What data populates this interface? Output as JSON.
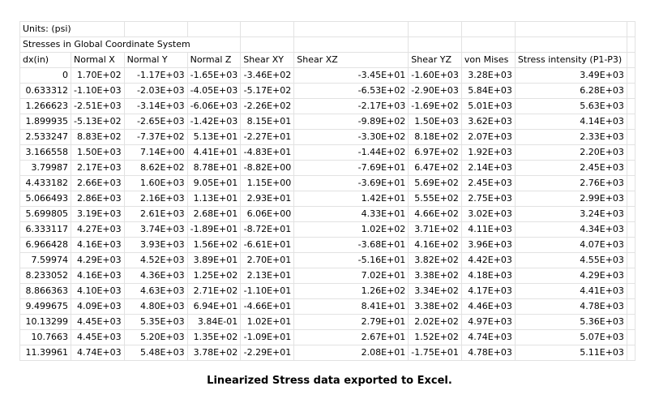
{
  "units_label": "Units: (psi)",
  "section_title": "Stresses in Global Coordinate System",
  "headers": [
    "dx(in)",
    "Normal X",
    "Normal Y",
    "Normal Z",
    "Shear XY",
    "Shear XZ",
    "Shear YZ",
    "von Mises",
    "Stress intensity (P1-P3)"
  ],
  "rows": [
    [
      "0",
      "1.70E+02",
      "-1.17E+03",
      "-1.65E+03",
      "-3.46E+02",
      "-3.45E+01",
      "-1.60E+03",
      "3.28E+03",
      "3.49E+03"
    ],
    [
      "0.633312",
      "-1.10E+03",
      "-2.03E+03",
      "-4.05E+03",
      "-5.17E+02",
      "-6.53E+02",
      "-2.90E+03",
      "5.84E+03",
      "6.28E+03"
    ],
    [
      "1.266623",
      "-2.51E+03",
      "-3.14E+03",
      "-6.06E+03",
      "-2.26E+02",
      "-2.17E+03",
      "-1.69E+02",
      "5.01E+03",
      "5.63E+03"
    ],
    [
      "1.899935",
      "-5.13E+02",
      "-2.65E+03",
      "-1.42E+03",
      "8.15E+01",
      "-9.89E+02",
      "1.50E+03",
      "3.62E+03",
      "4.14E+03"
    ],
    [
      "2.533247",
      "8.83E+02",
      "-7.37E+02",
      "5.13E+01",
      "-2.27E+01",
      "-3.30E+02",
      "8.18E+02",
      "2.07E+03",
      "2.33E+03"
    ],
    [
      "3.166558",
      "1.50E+03",
      "7.14E+00",
      "4.41E+01",
      "-4.83E+01",
      "-1.44E+02",
      "6.97E+02",
      "1.92E+03",
      "2.20E+03"
    ],
    [
      "3.79987",
      "2.17E+03",
      "8.62E+02",
      "8.78E+01",
      "-8.82E+00",
      "-7.69E+01",
      "6.47E+02",
      "2.14E+03",
      "2.45E+03"
    ],
    [
      "4.433182",
      "2.66E+03",
      "1.60E+03",
      "9.05E+01",
      "1.15E+00",
      "-3.69E+01",
      "5.69E+02",
      "2.45E+03",
      "2.76E+03"
    ],
    [
      "5.066493",
      "2.86E+03",
      "2.16E+03",
      "1.13E+01",
      "2.93E+01",
      "1.42E+01",
      "5.55E+02",
      "2.75E+03",
      "2.99E+03"
    ],
    [
      "5.699805",
      "3.19E+03",
      "2.61E+03",
      "2.68E+01",
      "6.06E+00",
      "4.33E+01",
      "4.66E+02",
      "3.02E+03",
      "3.24E+03"
    ],
    [
      "6.333117",
      "4.27E+03",
      "3.74E+03",
      "-1.89E+01",
      "-8.72E+01",
      "1.02E+02",
      "3.71E+02",
      "4.11E+03",
      "4.34E+03"
    ],
    [
      "6.966428",
      "4.16E+03",
      "3.93E+03",
      "1.56E+02",
      "-6.61E+01",
      "-3.68E+01",
      "4.16E+02",
      "3.96E+03",
      "4.07E+03"
    ],
    [
      "7.59974",
      "4.29E+03",
      "4.52E+03",
      "3.89E+01",
      "2.70E+01",
      "-5.16E+01",
      "3.82E+02",
      "4.42E+03",
      "4.55E+03"
    ],
    [
      "8.233052",
      "4.16E+03",
      "4.36E+03",
      "1.25E+02",
      "2.13E+01",
      "7.02E+01",
      "3.38E+02",
      "4.18E+03",
      "4.29E+03"
    ],
    [
      "8.866363",
      "4.10E+03",
      "4.63E+03",
      "2.71E+02",
      "-1.10E+01",
      "1.26E+02",
      "3.34E+02",
      "4.17E+03",
      "4.41E+03"
    ],
    [
      "9.499675",
      "4.09E+03",
      "4.80E+03",
      "6.94E+01",
      "-4.66E+01",
      "8.41E+01",
      "3.38E+02",
      "4.46E+03",
      "4.78E+03"
    ],
    [
      "10.13299",
      "4.45E+03",
      "5.35E+03",
      "3.84E-01",
      "1.02E+01",
      "2.79E+01",
      "2.02E+02",
      "4.97E+03",
      "5.36E+03"
    ],
    [
      "10.7663",
      "4.45E+03",
      "5.20E+03",
      "1.35E+02",
      "-1.09E+01",
      "2.67E+01",
      "1.52E+02",
      "4.74E+03",
      "5.07E+03"
    ],
    [
      "11.39961",
      "4.74E+03",
      "5.48E+03",
      "3.78E+02",
      "-2.29E+01",
      "2.08E+01",
      "-1.75E+01",
      "4.78E+03",
      "5.11E+03"
    ]
  ],
  "caption": "Linearized Stress data exported to Excel."
}
